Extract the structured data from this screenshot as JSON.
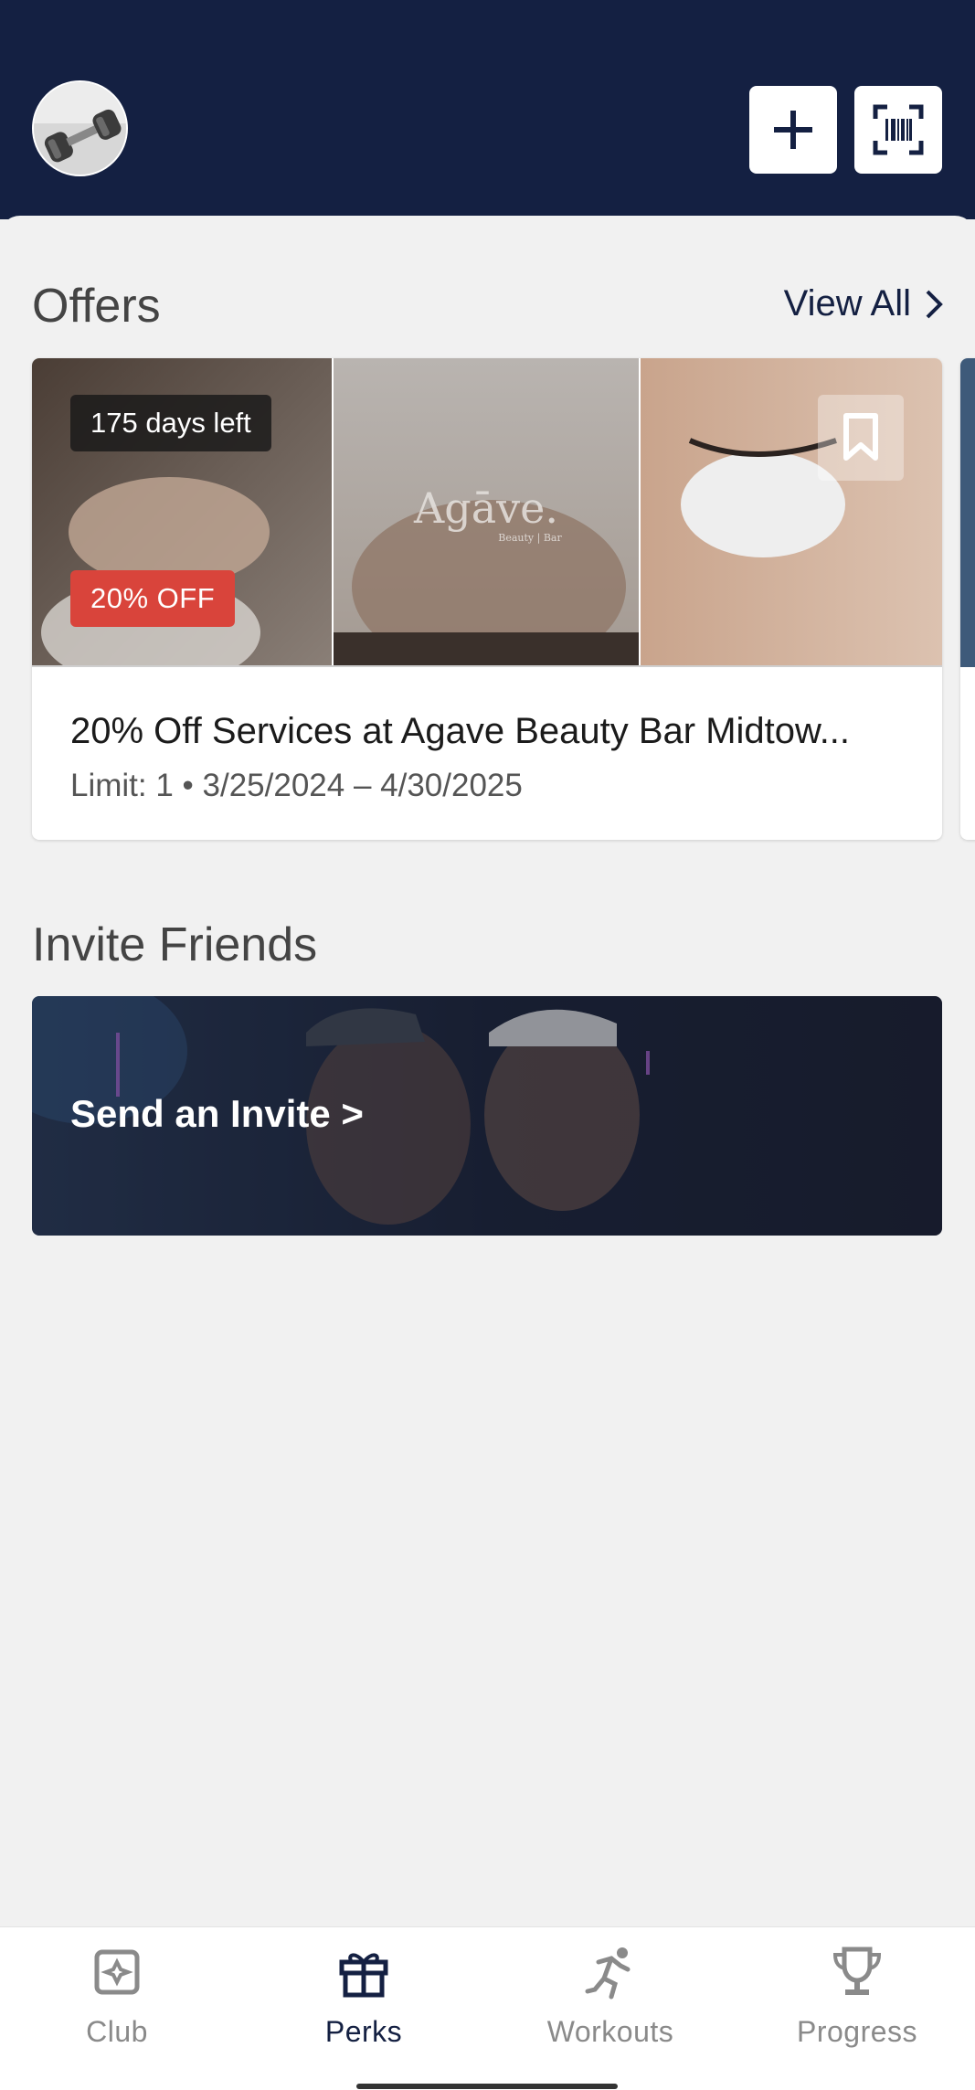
{
  "header": {
    "avatar_alt": "profile avatar",
    "add_button_icon": "plus-icon",
    "scan_button_icon": "barcode-scan-icon",
    "colors": {
      "background": "#142042",
      "button": "#ffffff"
    }
  },
  "offers": {
    "title": "Offers",
    "view_all_label": "View All",
    "card": {
      "days_left": "175 days left",
      "discount_badge": "20% OFF",
      "brand_watermark": "Agāve.",
      "brand_sub": "Beauty | Bar",
      "title": "20% Off Services at Agave Beauty Bar Midtow...",
      "subtitle": "Limit: 1 • 3/25/2024 – 4/30/2025",
      "bookmark_icon": "bookmark-icon",
      "colors": {
        "discount_badge": "#d9443b"
      }
    }
  },
  "invite": {
    "title": "Invite Friends",
    "banner_text": "Send an Invite >"
  },
  "bottom_nav": {
    "items": [
      {
        "label": "Club",
        "icon": "club-icon",
        "active": false
      },
      {
        "label": "Perks",
        "icon": "gift-icon",
        "active": true
      },
      {
        "label": "Workouts",
        "icon": "running-icon",
        "active": false
      },
      {
        "label": "Progress",
        "icon": "trophy-icon",
        "active": false
      }
    ],
    "colors": {
      "active": "#142042",
      "inactive": "#8a8a8a"
    }
  }
}
